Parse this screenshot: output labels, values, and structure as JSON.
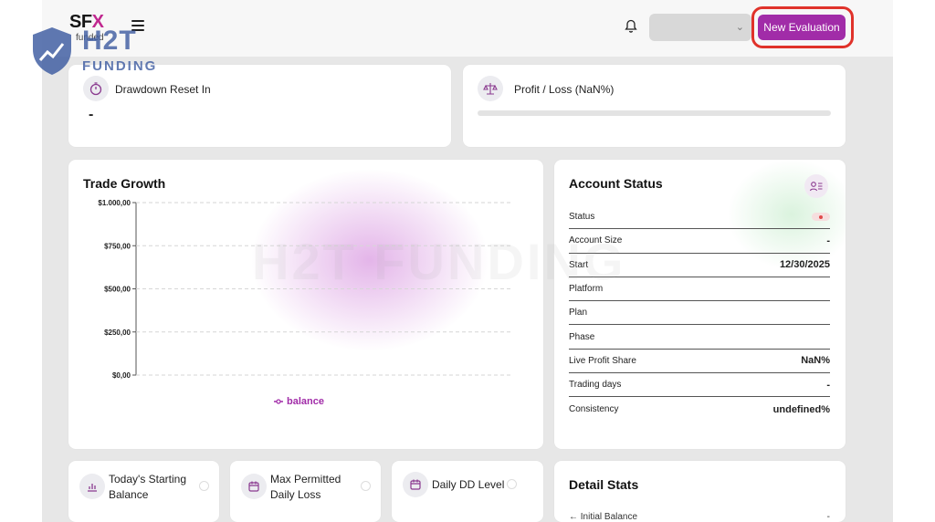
{
  "brand": {
    "name_prefix": "SF",
    "name_x": "X",
    "sub": "funded"
  },
  "watermark": {
    "title": "H2T",
    "subtitle": "FUNDING",
    "background_text": "H2T FUNDING"
  },
  "header": {
    "account_select_value": "",
    "new_evaluation_label": "New Evaluation"
  },
  "cards": {
    "drawdown": {
      "label": "Drawdown Reset In",
      "value": "-"
    },
    "profit_loss": {
      "label": "Profit / Loss (NaN%)",
      "progress": 0
    }
  },
  "trade_growth": {
    "title": "Trade Growth",
    "legend": "balance"
  },
  "chart_data": {
    "type": "line",
    "title": "Trade Growth",
    "y_ticks": [
      "$1.000,00",
      "$750,00",
      "$500,00",
      "$250,00",
      "$0,00"
    ],
    "ylim": [
      0,
      1000
    ],
    "grid": true,
    "series": [
      {
        "name": "balance",
        "values": []
      }
    ],
    "legend_position": "bottom-center"
  },
  "account_status": {
    "title": "Account Status",
    "rows": [
      {
        "label": "Status",
        "value": ""
      },
      {
        "label": "Account Size",
        "value": "-"
      },
      {
        "label": "Start",
        "value": "12/30/2025"
      },
      {
        "label": "Platform",
        "value": ""
      },
      {
        "label": "Plan",
        "value": ""
      },
      {
        "label": "Phase",
        "value": ""
      },
      {
        "label": "Live Profit Share",
        "value": "NaN%"
      },
      {
        "label": "Trading days",
        "value": "-"
      },
      {
        "label": "Consistency",
        "value": "undefined%"
      }
    ]
  },
  "bottom": {
    "starting_balance": {
      "line1": "Today's Starting",
      "line2": "Balance"
    },
    "max_loss": {
      "line1": "Max Permitted",
      "line2": "Daily Loss"
    },
    "daily_dd": {
      "label": "Daily DD Level"
    },
    "detail_stats": {
      "title": "Detail Stats",
      "initial_balance": "Initial Balance",
      "initial_value": "-"
    }
  },
  "colors": {
    "accent": "#a12ca8",
    "highlight": "#e0322a",
    "watermark": "#3c5aa0"
  }
}
